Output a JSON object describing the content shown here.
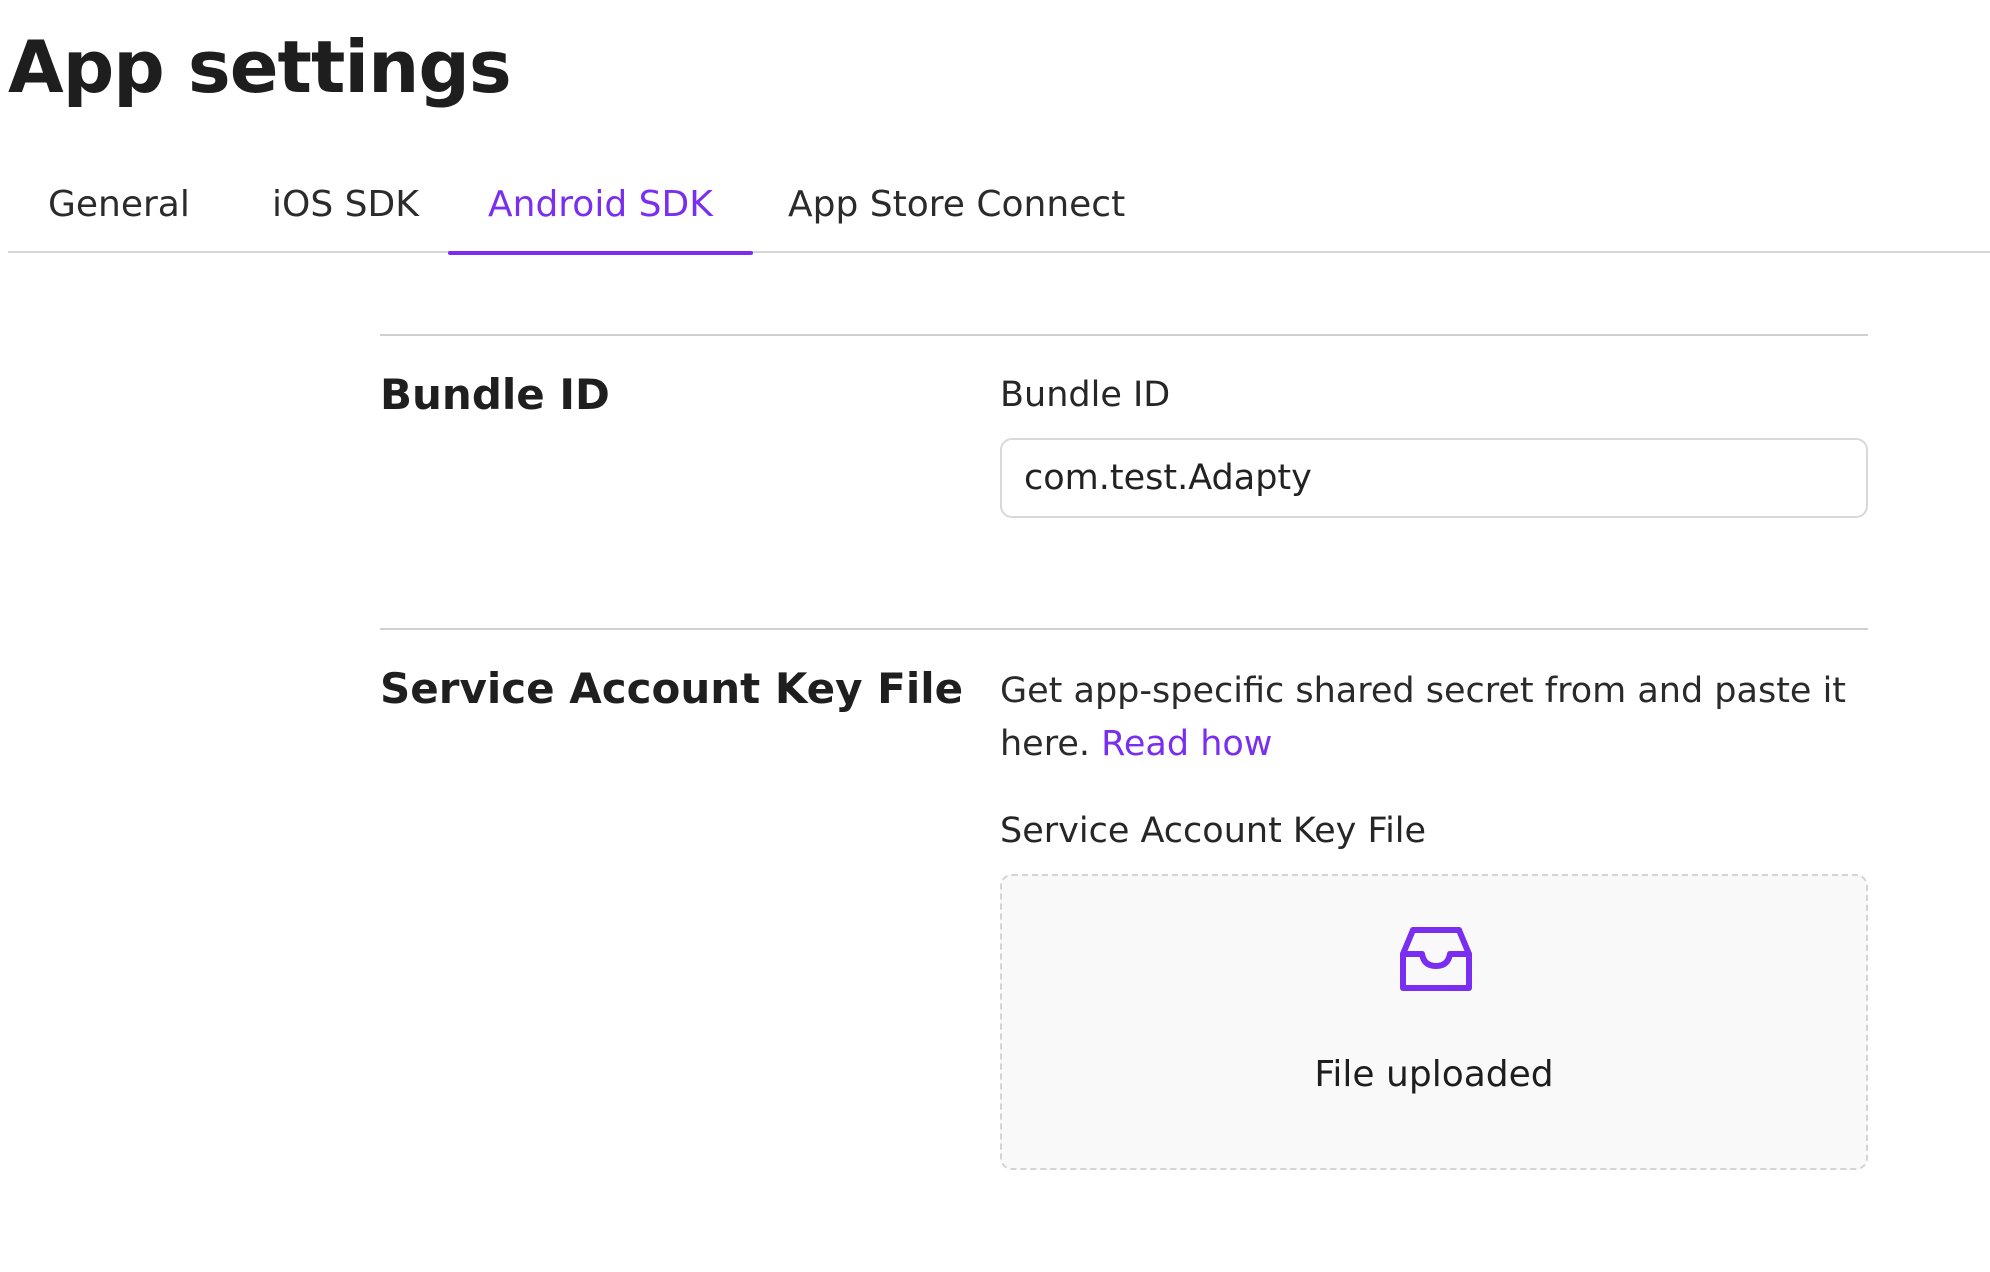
{
  "page": {
    "title": "App settings"
  },
  "tabs": [
    {
      "label": "General",
      "active": false
    },
    {
      "label": "iOS SDK",
      "active": false
    },
    {
      "label": "Android SDK",
      "active": true
    },
    {
      "label": "App Store Connect",
      "active": false
    }
  ],
  "colors": {
    "accent": "#7a2ff0",
    "text": "#222222",
    "divider": "#d0d0d0",
    "dropzone_bg": "#f9f9f9"
  },
  "bundle_section": {
    "title": "Bundle ID",
    "field_label": "Bundle ID",
    "value": "com.test.Adapty"
  },
  "service_account_section": {
    "title": "Service Account Key File",
    "helper_text": "Get app-specific shared secret from and paste it here.",
    "helper_link": "Read how",
    "field_label": "Service Account Key File",
    "upload_icon": "inbox-icon",
    "upload_status": "File uploaded"
  }
}
